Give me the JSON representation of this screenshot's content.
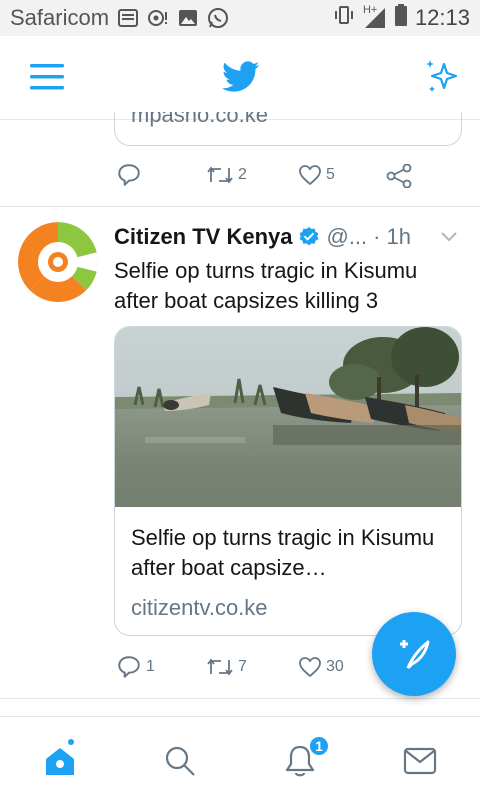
{
  "status_bar": {
    "carrier": "Safaricom",
    "network": "H+",
    "time": "12:13"
  },
  "top_bar": {
    "menu_icon": "hamburger-menu-icon",
    "logo_icon": "twitter-bird-icon",
    "sparkle_icon": "sparkle-icon"
  },
  "previous_tweet": {
    "card_url_fragment": "mpasho.co.ke",
    "retweet_count": "2",
    "like_count": "5"
  },
  "tweet": {
    "author_name": "Citizen TV Kenya",
    "handle": "@...",
    "separator": "·",
    "time_ago": "1h",
    "text": "Selfie op turns tragic in Kisumu after boat capsizes killing 3",
    "card": {
      "title": "Selfie op turns tragic in Kisumu after boat capsize…",
      "domain": "citizentv.co.ke"
    },
    "reply_count": "1",
    "retweet_count": "7",
    "like_count": "30"
  },
  "bottom_nav": {
    "notifications_badge": "1"
  },
  "colors": {
    "accent": "#1da1f2",
    "muted": "#657786",
    "border": "#e1e8ed"
  }
}
